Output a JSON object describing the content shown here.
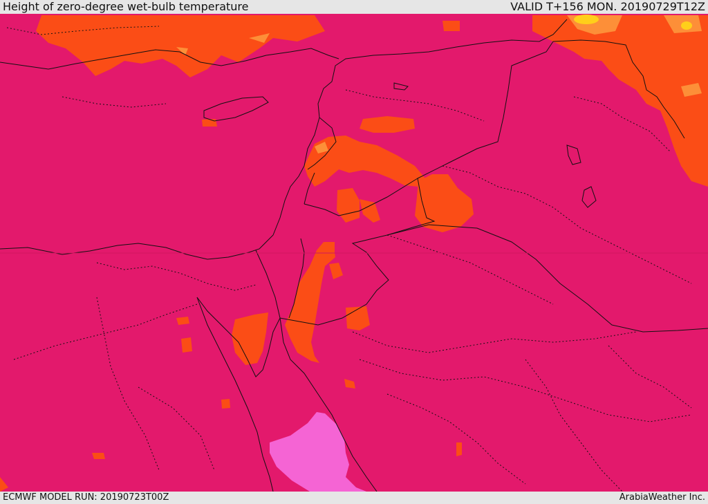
{
  "header": {
    "title": "Height of zero-degree wet-bulb temperature",
    "valid": "VALID T+156 MON. 20190729T12Z"
  },
  "footer": {
    "model_run": "ECMWF MODEL RUN: 20190723T00Z",
    "credit": "ArabiaWeather Inc."
  },
  "colors": {
    "base_magenta": "#e3196c",
    "orange": "#fb4d16",
    "light_orange": "#fd8f38",
    "yellow": "#ffcf1a",
    "pink": "#f564d4",
    "border": "#111111",
    "bar_bg": "#e6e6e6"
  }
}
